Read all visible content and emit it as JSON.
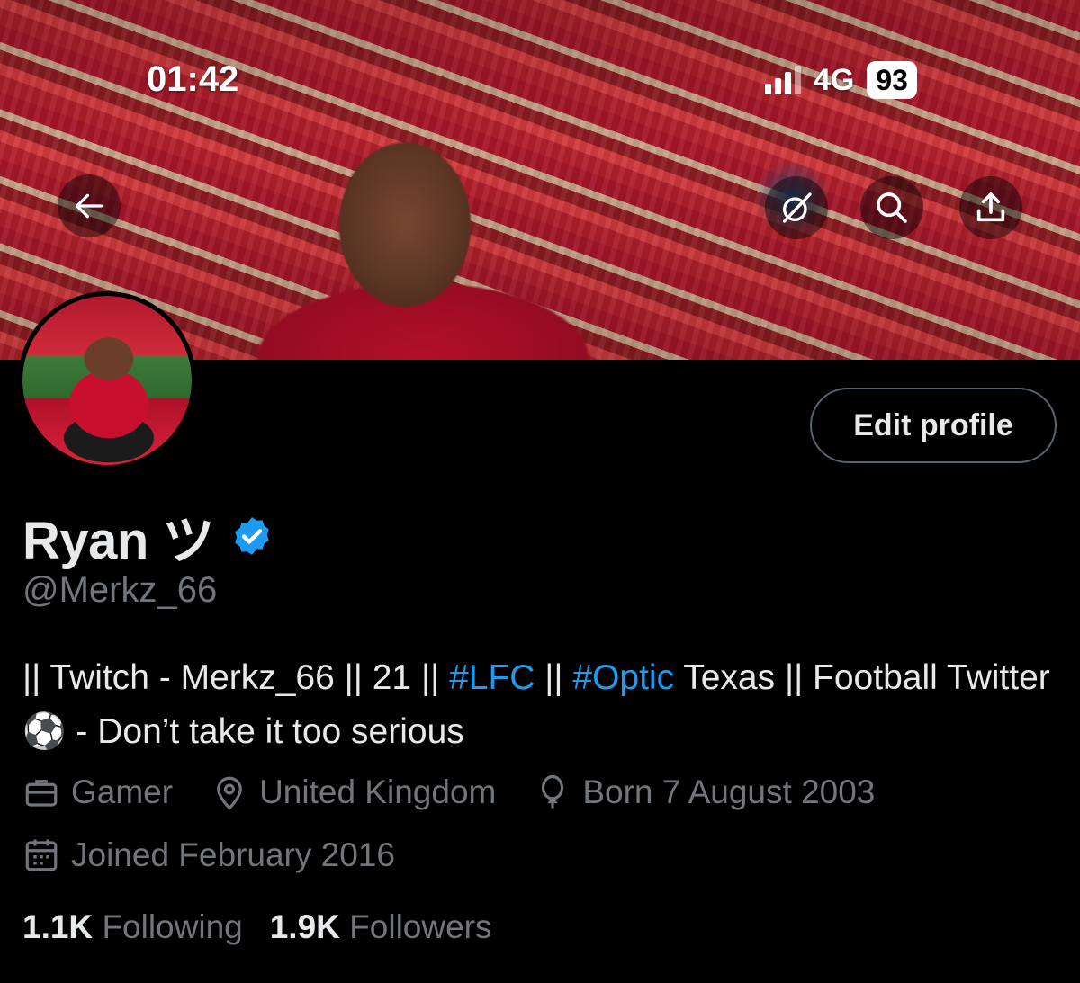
{
  "status_bar": {
    "time": "01:42",
    "network": "4G",
    "battery": "93"
  },
  "header": {
    "back_icon": "arrow-left-icon",
    "grok_icon": "grok-icon",
    "search_icon": "search-icon",
    "share_icon": "share-icon"
  },
  "profile": {
    "edit_button": "Edit profile",
    "name": "Ryan ツ",
    "verified_color": "#1d9bf0",
    "handle": "@Merkz_66",
    "bio": {
      "part1": "|| Twitch - Merkz_66 || 21 || ",
      "tag1": "#LFC",
      "part2": " || ",
      "tag2": "#Optic",
      "part3": " Texas || Football Twitter ⚽ - Don’t take it too serious"
    },
    "category": "Gamer",
    "location": "United Kingdom",
    "birthday": "Born 7 August 2003",
    "joined": "Joined February 2016",
    "following_count": "1.1K",
    "following_label": "Following",
    "followers_count": "1.9K",
    "followers_label": "Followers"
  },
  "colors": {
    "background": "#000000",
    "text": "#e7e9ea",
    "muted": "#71767b",
    "link": "#1d9bf0",
    "border": "#536471"
  }
}
